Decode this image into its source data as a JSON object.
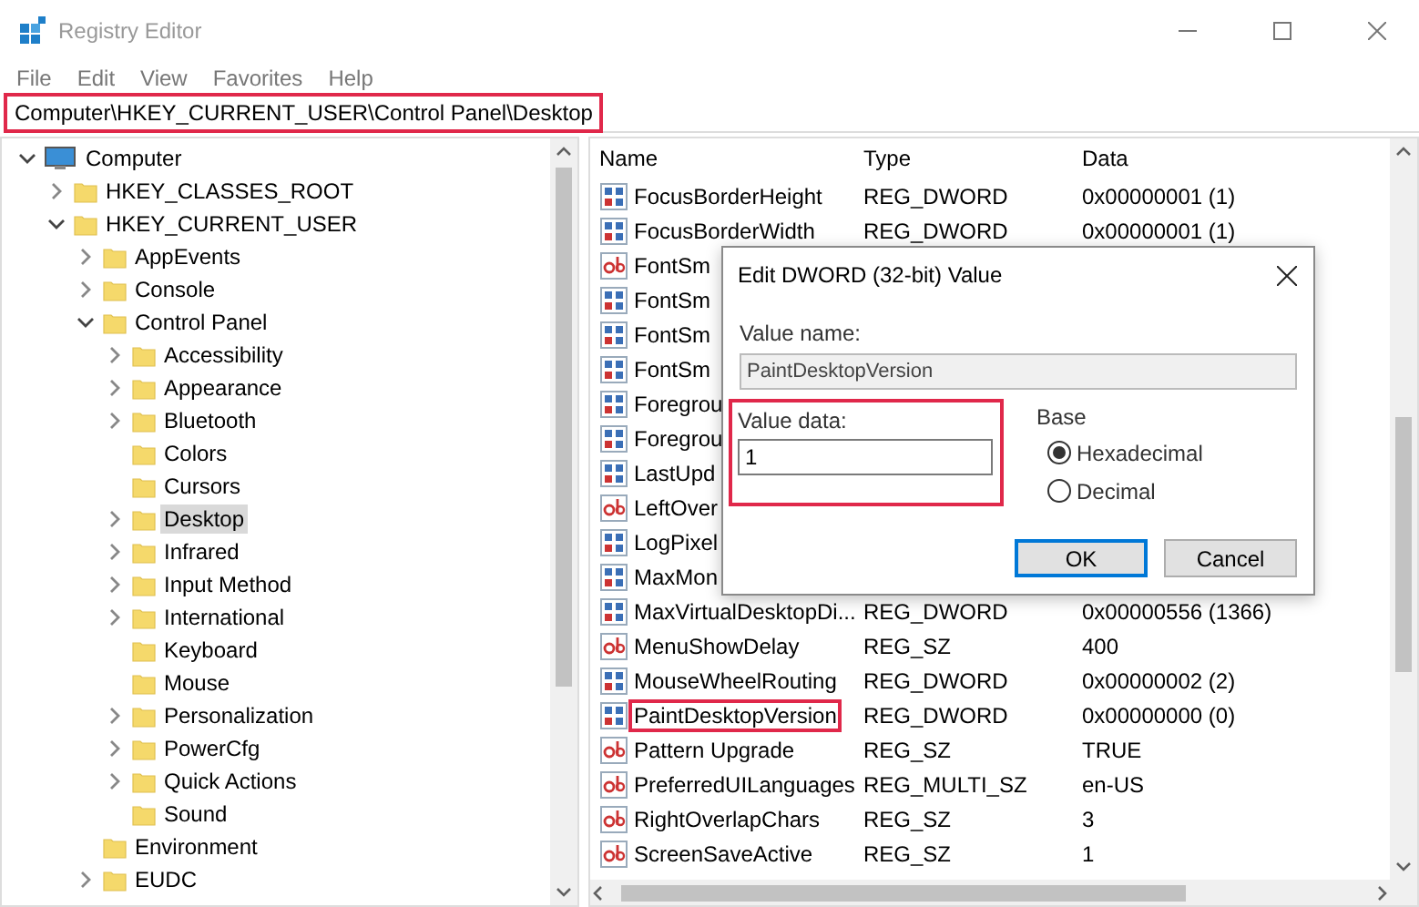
{
  "window": {
    "title": "Registry Editor"
  },
  "menu": [
    "File",
    "Edit",
    "View",
    "Favorites",
    "Help"
  ],
  "address_bar": {
    "value": "Computer\\HKEY_CURRENT_USER\\Control Panel\\Desktop",
    "highlighted": true
  },
  "tree": [
    {
      "label": "Computer",
      "kind": "computer",
      "expandable": true,
      "expanded": true,
      "selected": false,
      "children": [
        {
          "label": "HKEY_CLASSES_ROOT",
          "kind": "folder",
          "expandable": true,
          "expanded": false,
          "selected": false
        },
        {
          "label": "HKEY_CURRENT_USER",
          "kind": "folder",
          "expandable": true,
          "expanded": true,
          "selected": false,
          "children": [
            {
              "label": "AppEvents",
              "kind": "folder",
              "expandable": true,
              "expanded": false,
              "selected": false
            },
            {
              "label": "Console",
              "kind": "folder",
              "expandable": true,
              "expanded": false,
              "selected": false
            },
            {
              "label": "Control Panel",
              "kind": "folder",
              "expandable": true,
              "expanded": true,
              "selected": false,
              "children": [
                {
                  "label": "Accessibility",
                  "kind": "folder",
                  "expandable": true,
                  "expanded": false,
                  "selected": false
                },
                {
                  "label": "Appearance",
                  "kind": "folder",
                  "expandable": true,
                  "expanded": false,
                  "selected": false
                },
                {
                  "label": "Bluetooth",
                  "kind": "folder",
                  "expandable": true,
                  "expanded": false,
                  "selected": false
                },
                {
                  "label": "Colors",
                  "kind": "folder",
                  "expandable": false,
                  "expanded": false,
                  "selected": false
                },
                {
                  "label": "Cursors",
                  "kind": "folder",
                  "expandable": false,
                  "expanded": false,
                  "selected": false
                },
                {
                  "label": "Desktop",
                  "kind": "folder",
                  "expandable": true,
                  "expanded": false,
                  "selected": true
                },
                {
                  "label": "Infrared",
                  "kind": "folder",
                  "expandable": true,
                  "expanded": false,
                  "selected": false
                },
                {
                  "label": "Input Method",
                  "kind": "folder",
                  "expandable": true,
                  "expanded": false,
                  "selected": false
                },
                {
                  "label": "International",
                  "kind": "folder",
                  "expandable": true,
                  "expanded": false,
                  "selected": false
                },
                {
                  "label": "Keyboard",
                  "kind": "folder",
                  "expandable": false,
                  "expanded": false,
                  "selected": false
                },
                {
                  "label": "Mouse",
                  "kind": "folder",
                  "expandable": false,
                  "expanded": false,
                  "selected": false
                },
                {
                  "label": "Personalization",
                  "kind": "folder",
                  "expandable": true,
                  "expanded": false,
                  "selected": false
                },
                {
                  "label": "PowerCfg",
                  "kind": "folder",
                  "expandable": true,
                  "expanded": false,
                  "selected": false
                },
                {
                  "label": "Quick Actions",
                  "kind": "folder",
                  "expandable": true,
                  "expanded": false,
                  "selected": false
                },
                {
                  "label": "Sound",
                  "kind": "folder",
                  "expandable": false,
                  "expanded": false,
                  "selected": false
                }
              ]
            },
            {
              "label": "Environment",
              "kind": "folder",
              "expandable": false,
              "expanded": false,
              "selected": false
            },
            {
              "label": "EUDC",
              "kind": "folder",
              "expandable": true,
              "expanded": false,
              "selected": false
            }
          ]
        }
      ]
    }
  ],
  "columns": [
    "Name",
    "Type",
    "Data"
  ],
  "values": [
    {
      "kind": "dword",
      "name": "FocusBorderHeight",
      "type": "REG_DWORD",
      "data": "0x00000001 (1)",
      "highlighted": false
    },
    {
      "kind": "dword",
      "name": "FocusBorderWidth",
      "type": "REG_DWORD",
      "data": "0x00000001 (1)",
      "highlighted": false
    },
    {
      "kind": "string",
      "name": "FontSm",
      "highlighted": false
    },
    {
      "kind": "dword",
      "name": "FontSm",
      "highlighted": false
    },
    {
      "kind": "dword",
      "name": "FontSm",
      "highlighted": false
    },
    {
      "kind": "dword",
      "name": "FontSm",
      "highlighted": false
    },
    {
      "kind": "dword",
      "name": "Foregrou",
      "highlighted": false
    },
    {
      "kind": "dword",
      "name": "Foregrou",
      "highlighted": false
    },
    {
      "kind": "dword",
      "name": "LastUpd",
      "highlighted": false
    },
    {
      "kind": "string",
      "name": "LeftOver",
      "highlighted": false
    },
    {
      "kind": "dword",
      "name": "LogPixel",
      "highlighted": false
    },
    {
      "kind": "dword",
      "name": "MaxMon",
      "highlighted": false
    },
    {
      "kind": "dword",
      "name": "MaxVirtualDesktopDi...",
      "type": "REG_DWORD",
      "data": "0x00000556 (1366)",
      "highlighted": false
    },
    {
      "kind": "string",
      "name": "MenuShowDelay",
      "type": "REG_SZ",
      "data": "400",
      "highlighted": false
    },
    {
      "kind": "dword",
      "name": "MouseWheelRouting",
      "type": "REG_DWORD",
      "data": "0x00000002 (2)",
      "highlighted": false
    },
    {
      "kind": "dword",
      "name": "PaintDesktopVersion",
      "type": "REG_DWORD",
      "data": "0x00000000 (0)",
      "highlighted": true
    },
    {
      "kind": "string",
      "name": "Pattern Upgrade",
      "type": "REG_SZ",
      "data": "TRUE",
      "highlighted": false
    },
    {
      "kind": "string",
      "name": "PreferredUILanguages",
      "type": "REG_MULTI_SZ",
      "data": "en-US",
      "highlighted": false
    },
    {
      "kind": "string",
      "name": "RightOverlapChars",
      "type": "REG_SZ",
      "data": "3",
      "highlighted": false
    },
    {
      "kind": "string",
      "name": "ScreenSaveActive",
      "type": "REG_SZ",
      "data": "1",
      "highlighted": false
    }
  ],
  "dialog": {
    "title": "Edit DWORD (32-bit) Value",
    "value_name_label": "Value name:",
    "value_name": "PaintDesktopVersion",
    "value_data_label": "Value data:",
    "value_data": "1",
    "value_data_highlighted": true,
    "base_label": "Base",
    "base_options": [
      {
        "label": "Hexadecimal",
        "selected": true
      },
      {
        "label": "Decimal",
        "selected": false
      }
    ],
    "buttons": [
      {
        "label": "OK",
        "default": true
      },
      {
        "label": "Cancel",
        "default": false
      }
    ]
  }
}
